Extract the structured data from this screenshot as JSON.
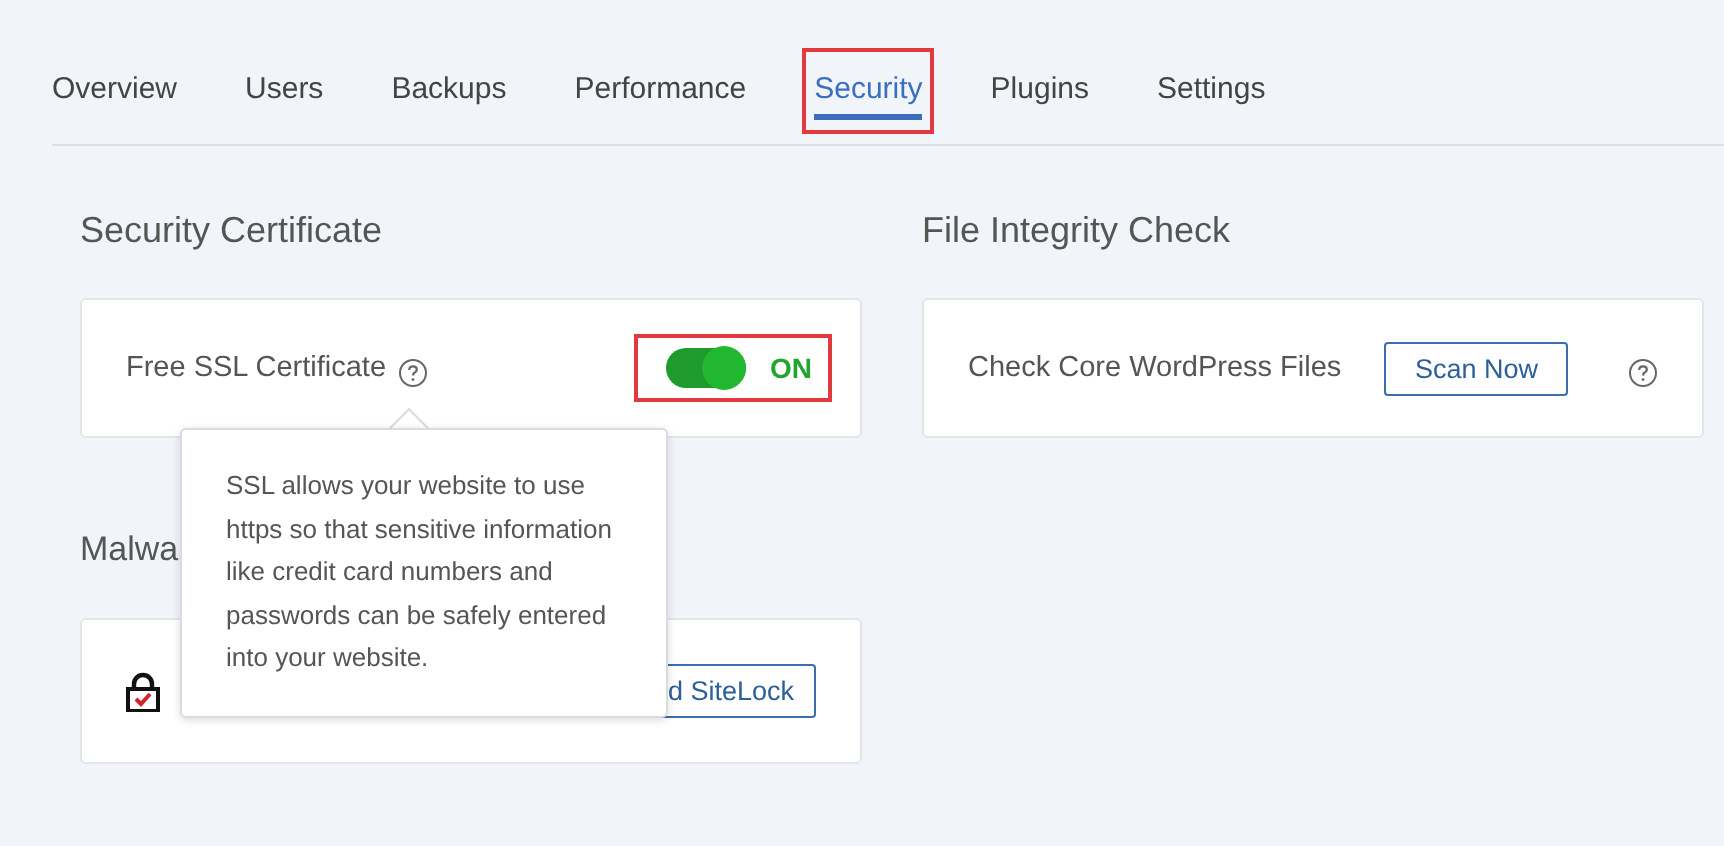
{
  "tabs": [
    {
      "label": "Overview",
      "selected": false,
      "highlighted": false
    },
    {
      "label": "Users",
      "selected": false,
      "highlighted": false
    },
    {
      "label": "Backups",
      "selected": false,
      "highlighted": false
    },
    {
      "label": "Performance",
      "selected": false,
      "highlighted": false
    },
    {
      "label": "Security",
      "selected": true,
      "highlighted": true
    },
    {
      "label": "Plugins",
      "selected": false,
      "highlighted": false
    },
    {
      "label": "Settings",
      "selected": false,
      "highlighted": false
    }
  ],
  "security_certificate": {
    "title": "Security Certificate",
    "label": "Free SSL Certificate",
    "toggle": {
      "on": true,
      "state_label": "ON",
      "highlighted": true
    }
  },
  "file_integrity": {
    "title": "File Integrity Check",
    "label": "Check Core WordPress Files",
    "button": "Scan Now"
  },
  "malware": {
    "title": "Malwa",
    "button": "d SiteLock"
  },
  "tooltip": {
    "text": "SSL allows your website to use https so that sensitive information like credit card numbers and passwords can be safely entered into your website."
  }
}
